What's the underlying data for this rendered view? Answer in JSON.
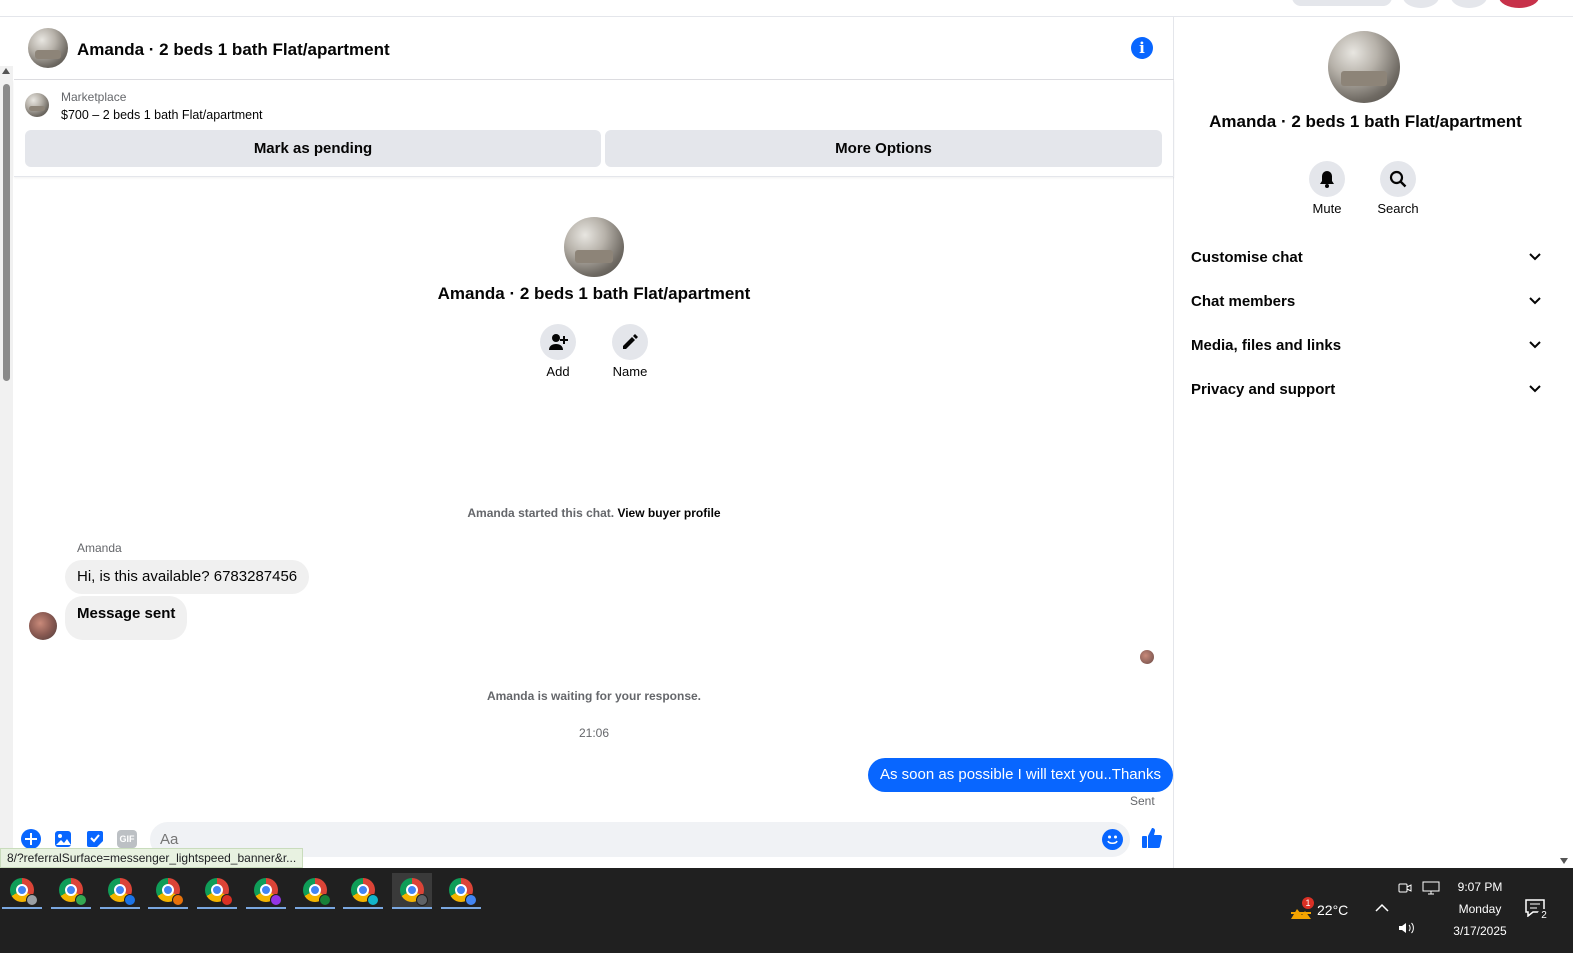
{
  "header": {
    "title": "Amanda · 2 beds 1 bath Flat/apartment"
  },
  "marketplace": {
    "label": "Marketplace",
    "listing": "$700 – 2 beds 1 bath Flat/apartment",
    "mark_pending_label": "Mark as pending",
    "more_options_label": "More Options"
  },
  "conversation": {
    "name": "Amanda · 2 beds 1 bath Flat/apartment",
    "add_label": "Add",
    "name_label": "Name",
    "started_text": "Amanda started this chat.",
    "view_buyer_profile": "View buyer profile",
    "sender": "Amanda",
    "messages_in": [
      "Hi, is this available? 6783287456",
      "Message sent"
    ],
    "waiting_text": "Amanda is waiting for your response.",
    "timestamp": "21:06",
    "message_out": "As soon as possible I will text you..Thanks",
    "status": "Sent"
  },
  "composer": {
    "placeholder": "Aa",
    "gif_label": "GIF",
    "url_tooltip": "8/?referralSurface=messenger_lightspeed_banner&r..."
  },
  "sidebar": {
    "name": "Amanda · 2 beds 1 bath Flat/apartment",
    "mute_label": "Mute",
    "search_label": "Search",
    "sections": [
      "Customise chat",
      "Chat members",
      "Media, files and links",
      "Privacy and support"
    ]
  },
  "taskbar": {
    "temperature": "22°C",
    "weather_badge": "1",
    "time": "9:07 PM",
    "day": "Monday",
    "date": "3/17/2025",
    "notifications": "2"
  },
  "colors": {
    "accent": "#0866ff",
    "bubble_in": "#f0f0f0",
    "button_bg": "#e4e6eb",
    "taskbar": "#202020"
  }
}
